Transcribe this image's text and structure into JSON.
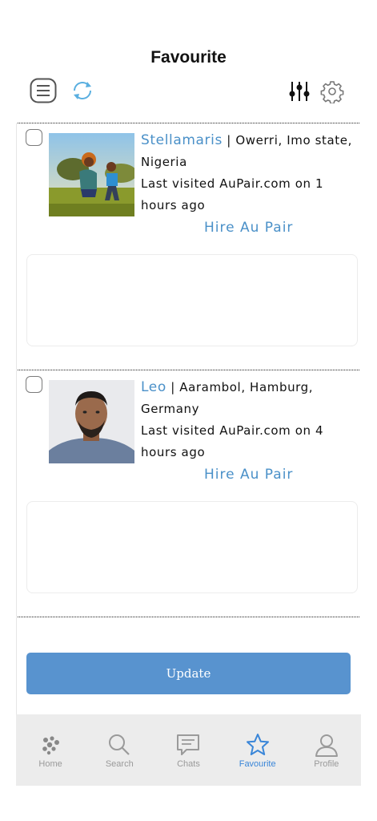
{
  "header": {
    "title": "Favourite",
    "icons": [
      "menu-icon",
      "refresh-icon",
      "filter-sliders-icon",
      "gear-icon"
    ],
    "accent_color": "#5aafe0"
  },
  "profiles": [
    {
      "name": "Stellamaris",
      "location": " | Owerri, Imo state, Nigeria",
      "last_visited": "Last visited AuPair.com on 1 hours ago",
      "hire_label": "Hire Au Pair"
    },
    {
      "name": "Leo",
      "location": " | Aarambol, Hamburg, Germany",
      "last_visited": "Last visited AuPair.com on 4 hours ago",
      "hire_label": "Hire Au Pair"
    }
  ],
  "update_label": "Update",
  "tabs": [
    {
      "label": "Home",
      "icon": "home-dots-icon",
      "active": false
    },
    {
      "label": "Search",
      "icon": "search-icon",
      "active": false
    },
    {
      "label": "Chats",
      "icon": "chat-icon",
      "active": false
    },
    {
      "label": "Favourite",
      "icon": "star-icon",
      "active": true
    },
    {
      "label": "Profile",
      "icon": "profile-icon",
      "active": false
    }
  ],
  "colors": {
    "link_blue": "#4a90c8",
    "button_blue": "#5893cf",
    "tab_active": "#3a86d8",
    "tabbar_bg": "#ececec"
  }
}
